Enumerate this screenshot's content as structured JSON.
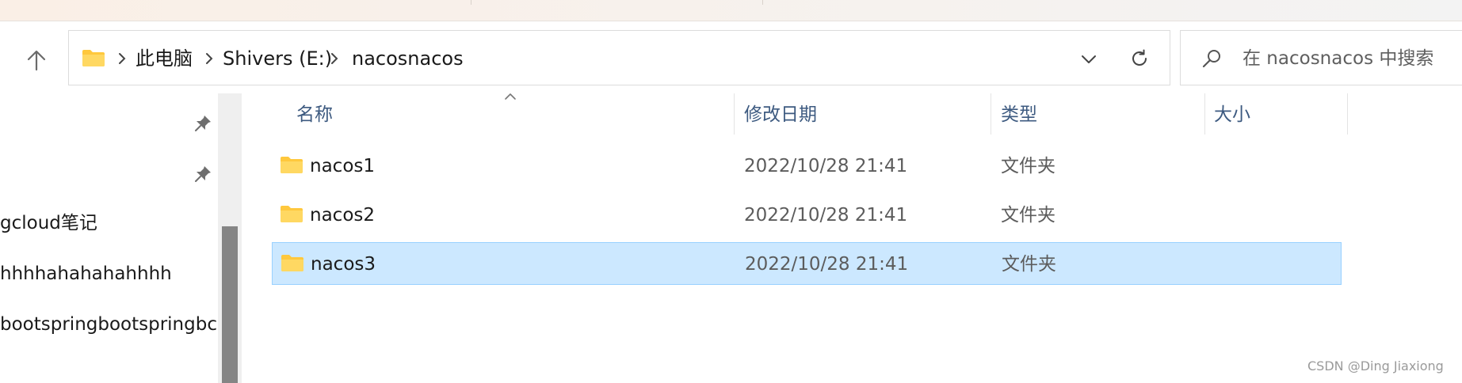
{
  "address_bar": {
    "crumbs": [
      "此电脑",
      "Shivers (E:)",
      "nacosnacos"
    ]
  },
  "search": {
    "placeholder": "在 nacosnacos 中搜索"
  },
  "nav_pane": {
    "items": [
      "gcloud笔记",
      "hhhhahahahahhhh",
      "bootspringbootspringbc"
    ]
  },
  "columns": {
    "name": "名称",
    "date_modified": "修改日期",
    "type": "类型",
    "size": "大小"
  },
  "files": [
    {
      "name": "nacos1",
      "date_modified": "2022/10/28 21:41",
      "type": "文件夹",
      "selected": false
    },
    {
      "name": "nacos2",
      "date_modified": "2022/10/28 21:41",
      "type": "文件夹",
      "selected": false
    },
    {
      "name": "nacos3",
      "date_modified": "2022/10/28 21:41",
      "type": "文件夹",
      "selected": true
    }
  ],
  "watermark": "CSDN @Ding Jiaxiong",
  "colors": {
    "selection_fill": "#cce8ff",
    "selection_border": "#99d1ff",
    "folder_yellow": "#ffc83d",
    "header_text": "#3d5a80"
  },
  "icons": [
    "up-arrow-icon",
    "folder-icon",
    "chevron-right-icon",
    "chevron-down-icon",
    "refresh-icon",
    "search-icon",
    "pin-icon",
    "sort-ascending-icon"
  ]
}
